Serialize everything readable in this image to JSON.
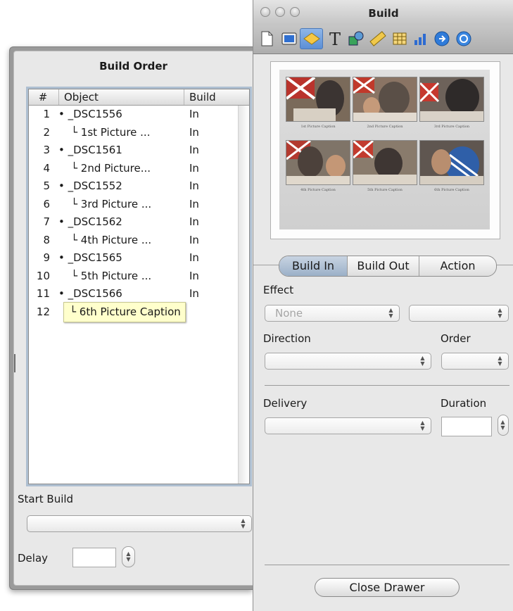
{
  "build_order": {
    "title": "Build Order",
    "columns": {
      "num": "#",
      "object": "Object",
      "build": "Build"
    },
    "rows": [
      {
        "num": "1",
        "object": "• _DSC1556",
        "build": "In"
      },
      {
        "num": "2",
        "object": "└ 1st Picture ...",
        "build": "In"
      },
      {
        "num": "3",
        "object": "• _DSC1561",
        "build": "In"
      },
      {
        "num": "4",
        "object": "└ 2nd Picture...",
        "build": "In"
      },
      {
        "num": "5",
        "object": "• _DSC1552",
        "build": "In"
      },
      {
        "num": "6",
        "object": "└ 3rd Picture ...",
        "build": "In"
      },
      {
        "num": "7",
        "object": "• _DSC1562",
        "build": "In"
      },
      {
        "num": "8",
        "object": "└ 4th Picture ...",
        "build": "In"
      },
      {
        "num": "9",
        "object": "• _DSC1565",
        "build": "In"
      },
      {
        "num": "10",
        "object": "└ 5th Picture ...",
        "build": "In"
      },
      {
        "num": "11",
        "object": "• _DSC1566",
        "build": "In"
      },
      {
        "num": "12",
        "object": "└ 6th Picture Caption",
        "build": ""
      }
    ],
    "start_build_label": "Start Build",
    "start_build_value": "",
    "delay_label": "Delay",
    "delay_value": ""
  },
  "inspector": {
    "window_title": "Build",
    "toolbar_icons": [
      "document-icon",
      "slide-icon",
      "build-icon",
      "text-icon",
      "graphic-icon",
      "metrics-icon",
      "table-icon",
      "chart-icon",
      "hyperlink-icon",
      "quicktime-icon"
    ],
    "active_tool": 2,
    "preview_captions": [
      "1st Picture Caption",
      "2nd Picture Caption",
      "3rd Picture Caption",
      "4th Picture Caption",
      "5th Picture Caption",
      "6th Picture Caption"
    ],
    "tabs": [
      "Build In",
      "Build Out",
      "Action"
    ],
    "active_tab": 0,
    "effect_label": "Effect",
    "effect_value": "None",
    "effect_secondary_value": "",
    "direction_label": "Direction",
    "direction_value": "",
    "order_label": "Order",
    "order_value": "",
    "delivery_label": "Delivery",
    "delivery_value": "",
    "duration_label": "Duration",
    "duration_value": "",
    "close_button": "Close Drawer"
  }
}
